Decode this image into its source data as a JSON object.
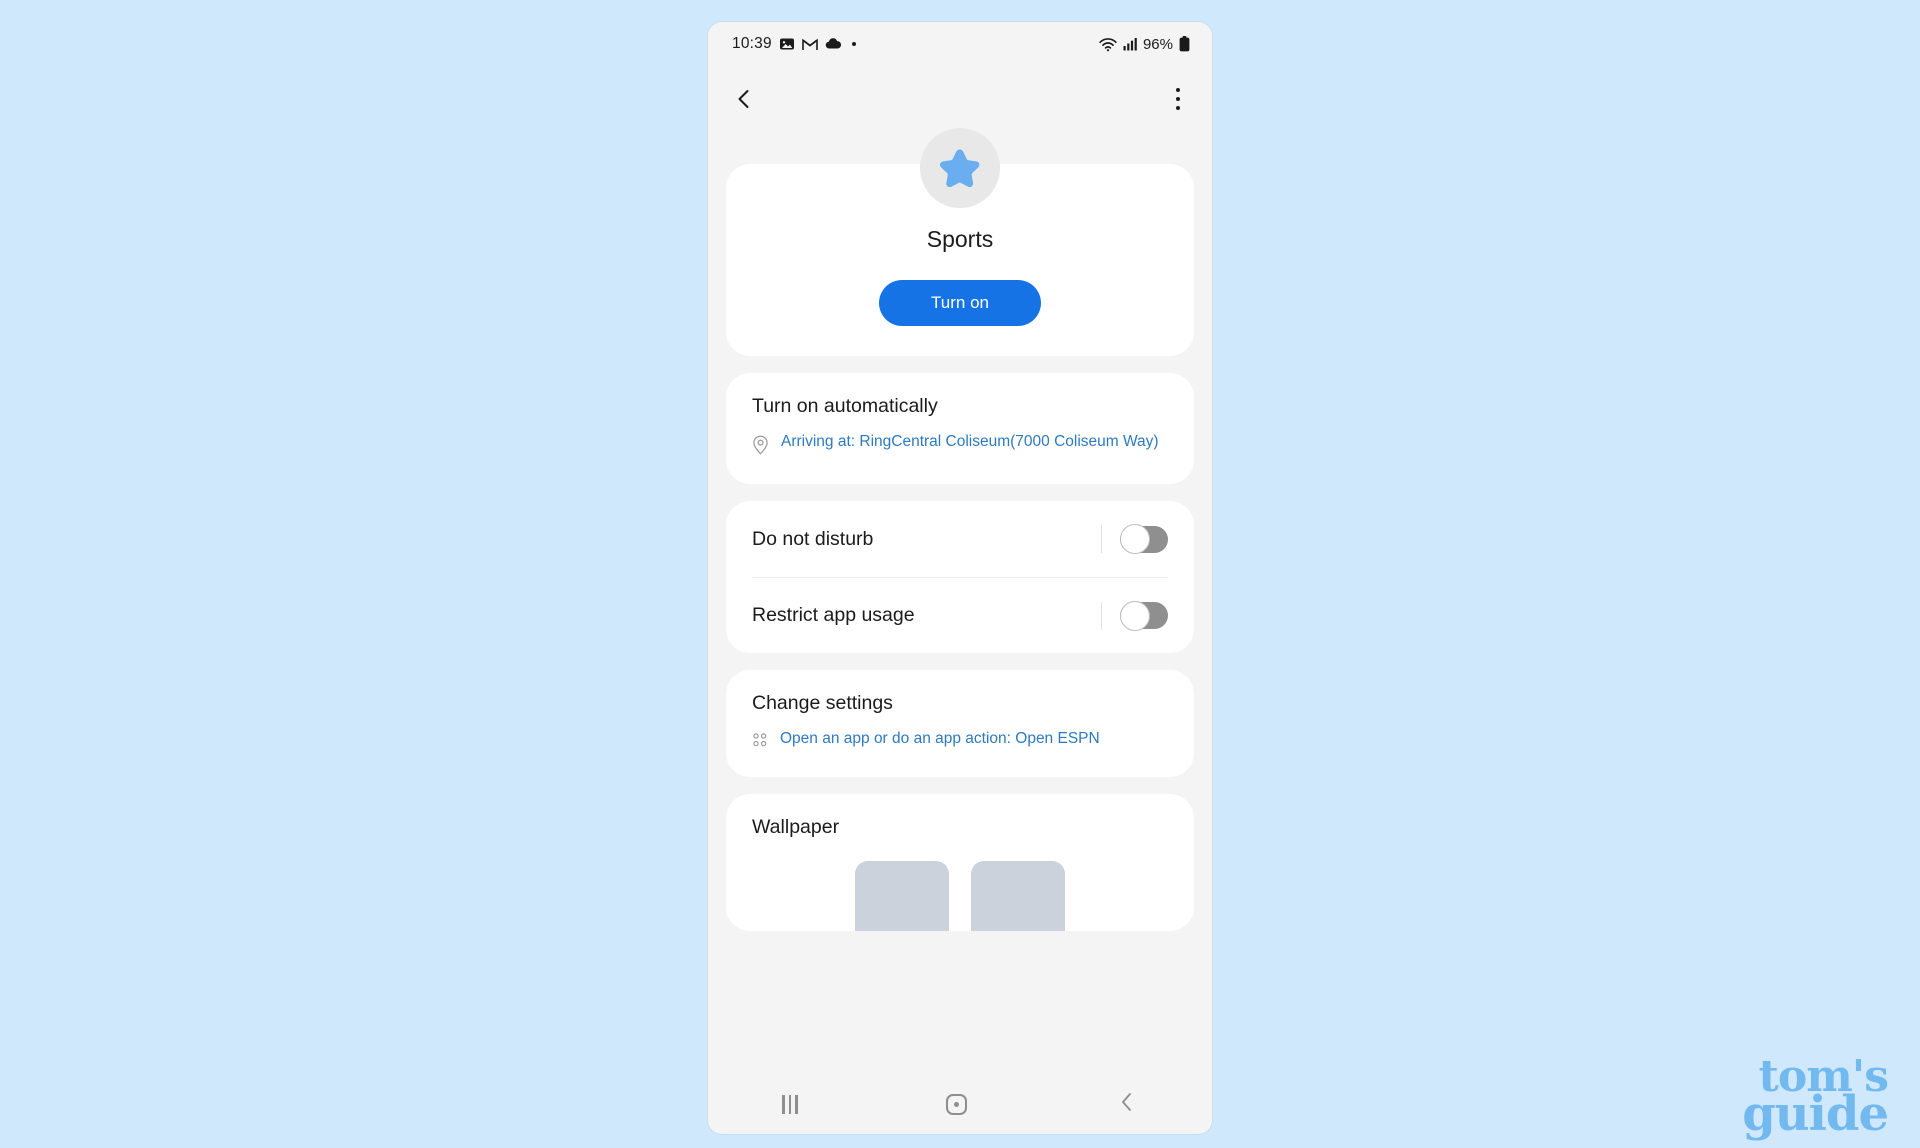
{
  "watermark": {
    "line1": "tom's",
    "line2": "guide",
    "color": "#72b9ef"
  },
  "phone": {
    "status_bar": {
      "time": "10:39",
      "left_icons": [
        "photo-icon",
        "gmail-icon",
        "cloud-icon",
        "dot-icon"
      ],
      "wifi_icon": "wifi-icon",
      "signal_icon": "cellular-signal-icon",
      "battery_percent": "96%",
      "battery_icon": "battery-full-icon"
    },
    "app_bar": {
      "back_icon": "chevron-left-icon",
      "more_icon": "overflow-menu-icon"
    },
    "hero": {
      "avatar_icon": "star-icon",
      "accent_color": "#6aaef0",
      "title": "Sports",
      "primary_button": "Turn on",
      "primary_button_color": "#1573e6"
    },
    "auto_card": {
      "title": "Turn on automatically",
      "condition_icon": "location-pin-icon",
      "condition_text": "Arriving at: RingCentral Coliseum(7000 Coliseum Way)",
      "link_color": "#2d7ac0"
    },
    "toggles": [
      {
        "label": "Do not disturb",
        "state": "off"
      },
      {
        "label": "Restrict app usage",
        "state": "off"
      }
    ],
    "change_settings_card": {
      "title": "Change settings",
      "action_icon": "app-grid-icon",
      "action_text": "Open an app or do an app action: Open ESPN"
    },
    "wallpaper_card": {
      "title": "Wallpaper",
      "thumbnails": [
        "wallpaper-thumbnail-1",
        "wallpaper-thumbnail-2"
      ]
    },
    "nav_bar": {
      "recents": "recents-icon",
      "home": "home-icon",
      "back": "back-icon"
    }
  }
}
